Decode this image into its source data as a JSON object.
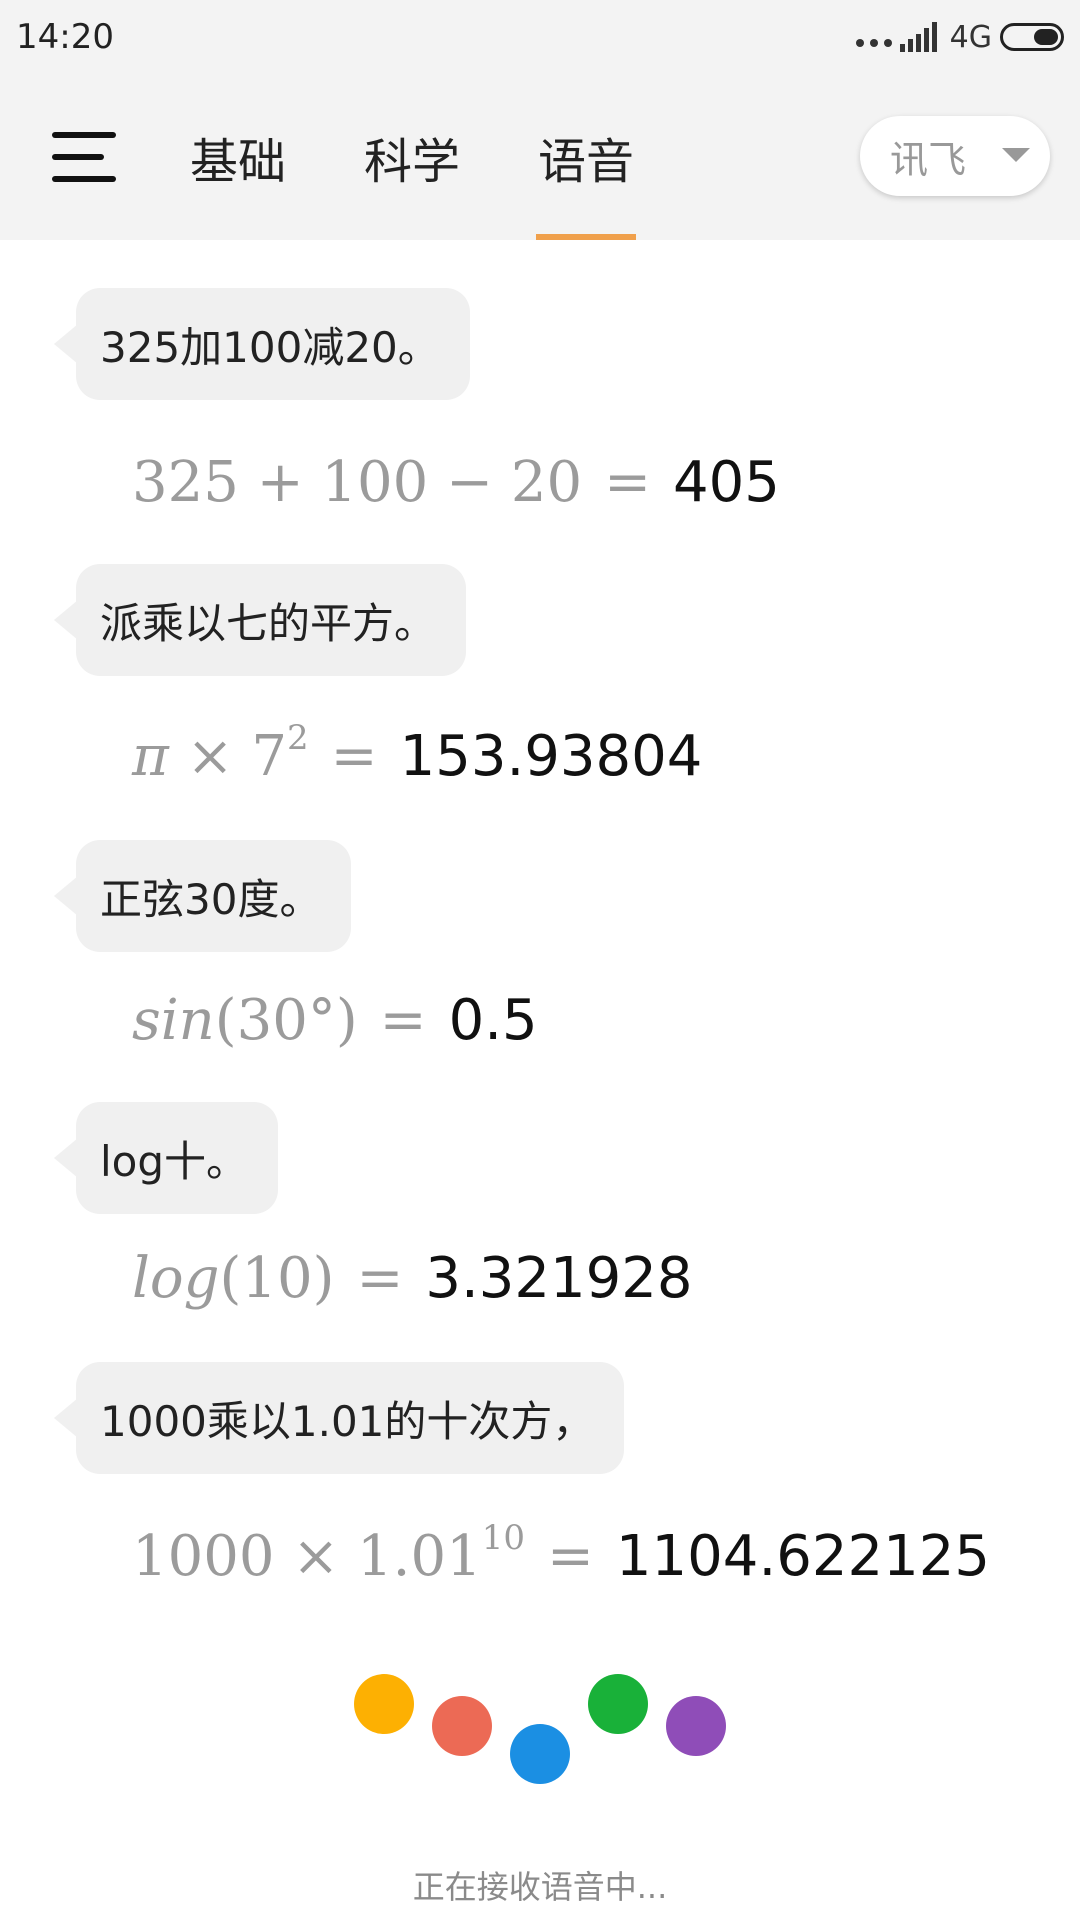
{
  "status_bar": {
    "time": "14:20",
    "network": "4G"
  },
  "app_bar": {
    "tabs": [
      {
        "label": "基础",
        "active": false
      },
      {
        "label": "科学",
        "active": false
      },
      {
        "label": "语音",
        "active": true
      }
    ],
    "accent_color": "#f0a04b",
    "engine_select": {
      "value": "讯飞"
    }
  },
  "conversation": [
    {
      "speech": "325加100减20。",
      "expression": "325 + 100 − 20",
      "answer": "405"
    },
    {
      "speech": "派乘以七的平方。",
      "expression_parts": {
        "pi": "π",
        "times": "×",
        "base": "7",
        "exponent": "2"
      },
      "answer": "153.93804"
    },
    {
      "speech": "正弦30度。",
      "expression_parts": {
        "func": "sin",
        "arg": "(30°)"
      },
      "answer": "0.5"
    },
    {
      "speech": "log十。",
      "expression_parts": {
        "func": "log",
        "arg": "(10)"
      },
      "answer": "3.321928"
    },
    {
      "speech": "1000乘以1.01的十次方，",
      "expression_parts": {
        "base": "1000 × 1.01",
        "exponent": "10"
      },
      "answer": "1104.622125"
    }
  ],
  "equals_sign": "=",
  "voice_indicator": {
    "dot_colors": [
      "#fdb002",
      "#ec6a55",
      "#1b8fe3",
      "#19b139",
      "#8f4db8"
    ],
    "status_text": "正在接收语音中..."
  }
}
